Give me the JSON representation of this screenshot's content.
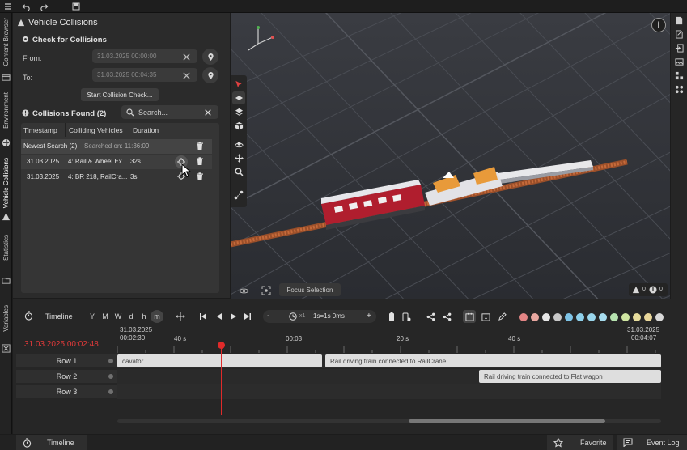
{
  "vertical_tabs": {
    "content_browser": "Content Browser",
    "environment": "Environment",
    "vehicle_collisions": "Vehicle Collisions",
    "statistics": "Statistics",
    "variables": "Variables"
  },
  "panel": {
    "title": "Vehicle Collisions",
    "check_title": "Check for Collisions",
    "from_label": "From:",
    "from_value": "31.03.2025 00:00:00",
    "to_label": "To:",
    "to_value": "31.03.2025 00:04:35",
    "start_button": "Start Collision Check...",
    "found_title": "Collisions Found (2)",
    "search_placeholder": "Search...",
    "columns": [
      "Timestamp",
      "Colliding Vehicles",
      "Duration"
    ],
    "group": {
      "name": "Newest Search (2)",
      "searched_on": "Searched on: 11:36:09"
    },
    "rows": [
      {
        "timestamp": "31.03.2025",
        "vehicles": "4: Rail & Wheel Ex...",
        "duration": "32s"
      },
      {
        "timestamp": "31.03.2025",
        "vehicles": "4: BR 218, RailCra...",
        "duration": "3s"
      }
    ]
  },
  "viewport": {
    "focus_selection": "Focus Selection",
    "warning_count": "0",
    "info_count": "0"
  },
  "timeline": {
    "title": "Timeline",
    "zoom_chips": [
      "Y",
      "M",
      "W",
      "d",
      "h",
      "m"
    ],
    "selected_chip": "m",
    "minus": "-",
    "speed_prefix": "x1",
    "speed": "1s=1s 0ms",
    "plus": "+",
    "current_time": "31.03.2025 00:02:48",
    "start_date": "31.03.2025",
    "start_time": "00:02:30",
    "end_date": "31.03.2025",
    "end_time": "00:04:07",
    "ticks": [
      "40 s",
      "00:03",
      "20 s",
      "40 s"
    ],
    "rows": [
      "Row 1",
      "Row 2",
      "Row 3"
    ],
    "clips": [
      {
        "row": 1,
        "label": "cavator"
      },
      {
        "row": 1,
        "label": "Rail driving train connected to RailCrane"
      },
      {
        "row": 2,
        "label": "Rail driving train connected to Flat wagon"
      }
    ],
    "palette": [
      "#e38585",
      "#e8a7a0",
      "#e6e6e6",
      "#c8c8c8",
      "#7fc4e6",
      "#8ed0ea",
      "#9ad6ec",
      "#a6dcee",
      "#b7e3b0",
      "#d0e6a2",
      "#e6dc9c",
      "#e9d79a",
      "#d8d8d8"
    ]
  },
  "statusbar": {
    "timeline_tab": "Timeline",
    "favorite": "Favorite",
    "event_log": "Event Log"
  }
}
